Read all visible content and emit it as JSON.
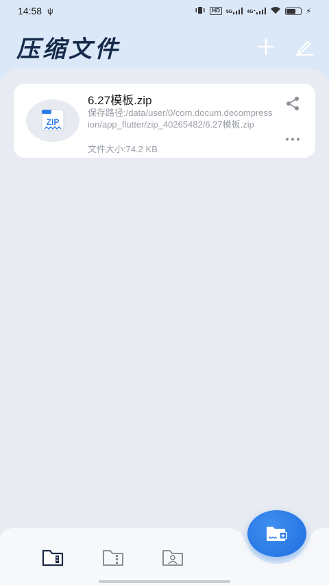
{
  "status_bar": {
    "time": "14:58",
    "usb_icon": "usb-icon",
    "hd_label": "HD",
    "network1": "5G",
    "network2": "4G⁺"
  },
  "header": {
    "title": "压缩文件",
    "add_icon": "plus-icon",
    "edit_icon": "edit-icon"
  },
  "files": [
    {
      "name": "6.27模板.zip",
      "thumb_label": "ZIP",
      "path": "保存路径:/data/user/0/com.docum.decompression/app_flutter/zip_40265482/6.27模板.zip",
      "size": "文件大小:74.2 KB"
    }
  ],
  "bottom_nav": {
    "tabs": [
      "zip-folder-icon",
      "folder-zip-icon",
      "folder-user-icon"
    ]
  },
  "colors": {
    "accent": "#1e6fe0",
    "title": "#162a4a",
    "background": "#dbe8f8",
    "panel": "#e8ecf2"
  }
}
